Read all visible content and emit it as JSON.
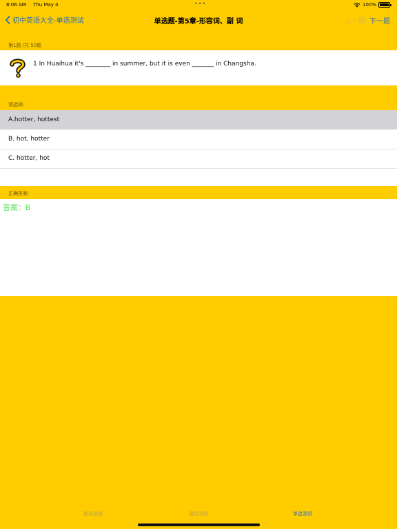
{
  "status_bar": {
    "time": "8:06 AM",
    "date": "Thu May 4",
    "dots": "•••",
    "battery_percent": "100%"
  },
  "nav": {
    "back_label": "初中英语大全-单选测试",
    "title": "单选题-第5章-形容词、副 词",
    "prev_label": "上一题",
    "next_label": "下一题"
  },
  "question": {
    "progress": "第1题 /共 50题",
    "text": "1  In Huaihua it's ________ in summer, but it is even _______ in Changsha.",
    "icon": "question-mark-icon"
  },
  "options": {
    "prompt": "请选择:",
    "items": [
      {
        "label": "A.hotter, hottest",
        "selected": true
      },
      {
        "label": "B. hot, hotter",
        "selected": false
      },
      {
        "label": "C. hotter, hot",
        "selected": false
      }
    ]
  },
  "answer": {
    "header": "正确答案:",
    "text": "答案：B"
  },
  "tabs": [
    {
      "label": "笔记总结",
      "active": false
    },
    {
      "label": "填空测试",
      "active": false
    },
    {
      "label": "单选测试",
      "active": true
    }
  ],
  "colors": {
    "background": "#FFCC00",
    "accent": "#2a6fb8",
    "selected_option": "#D3D3D6",
    "answer_green": "#5BE35B"
  }
}
